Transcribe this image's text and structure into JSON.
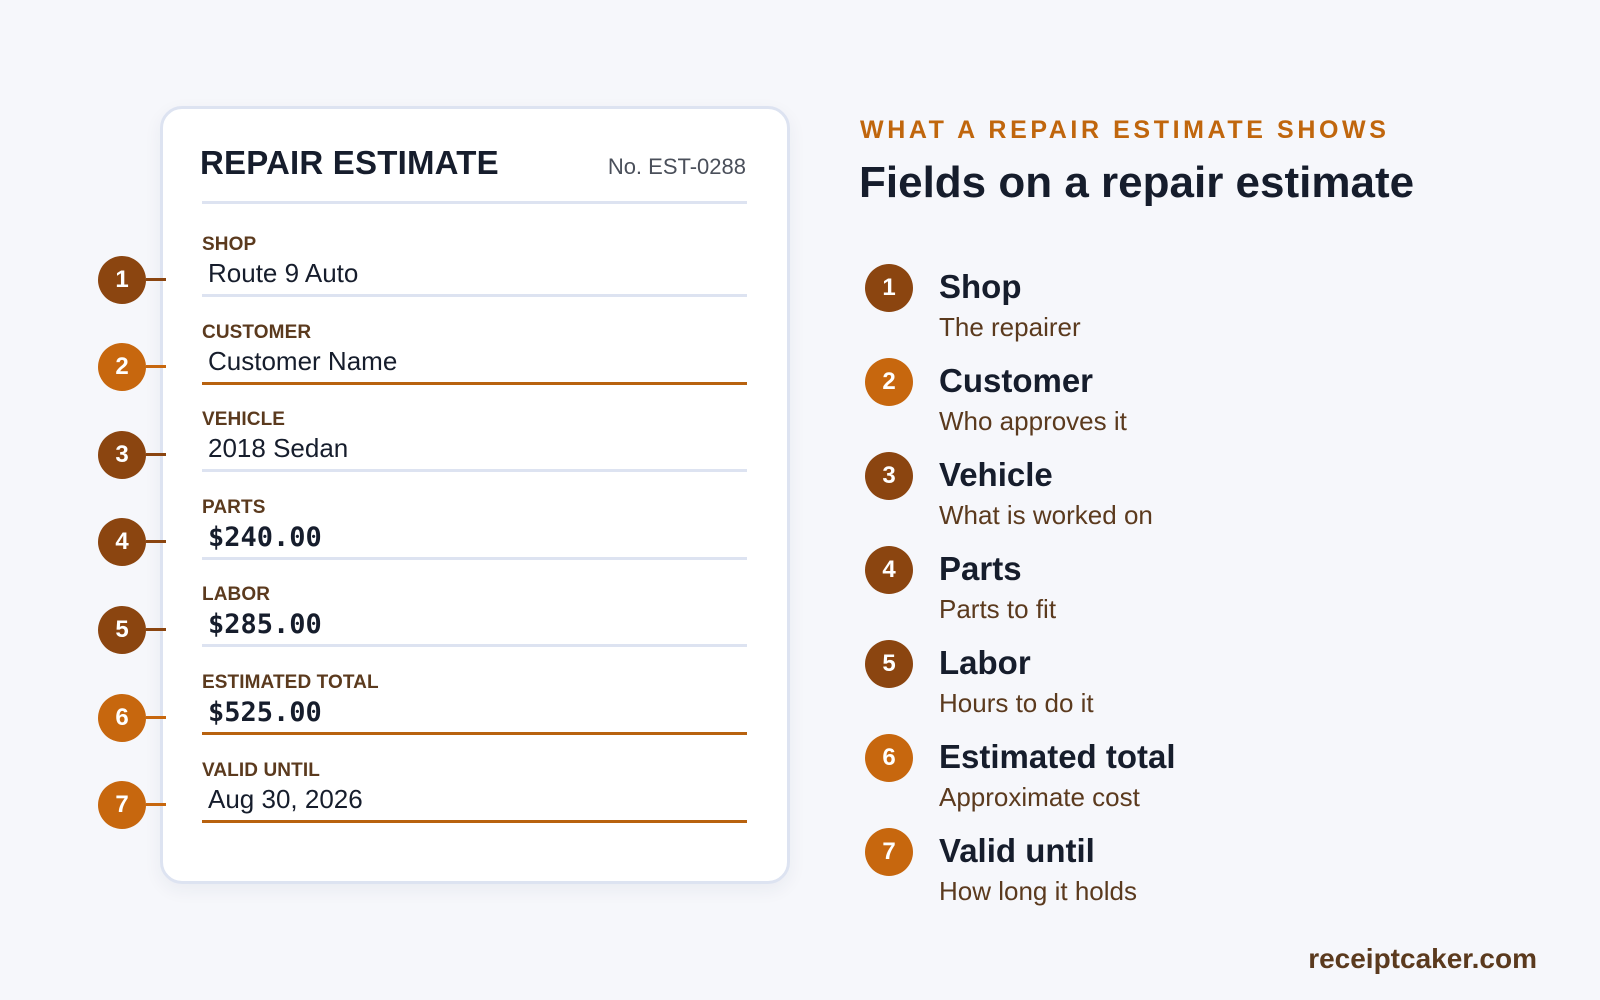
{
  "card": {
    "title": "REPAIR ESTIMATE",
    "number": "No. EST-0288",
    "fields": [
      {
        "marker": "1",
        "label": "SHOP",
        "value": "Route 9 Auto"
      },
      {
        "marker": "2",
        "label": "CUSTOMER",
        "value": "Customer Name"
      },
      {
        "marker": "3",
        "label": "VEHICLE",
        "value": "2018 Sedan"
      },
      {
        "marker": "4",
        "label": "PARTS",
        "value": "$240.00"
      },
      {
        "marker": "5",
        "label": "LABOR",
        "value": "$285.00"
      },
      {
        "marker": "6",
        "label": "ESTIMATED TOTAL",
        "value": "$525.00"
      },
      {
        "marker": "7",
        "label": "VALID UNTIL",
        "value": "Aug 30, 2026"
      }
    ]
  },
  "legend": {
    "eyebrow": "WHAT A REPAIR ESTIMATE SHOWS",
    "heading": "Fields on a repair estimate",
    "items": [
      {
        "number": "1",
        "title": "Shop",
        "description": "The repairer"
      },
      {
        "number": "2",
        "title": "Customer",
        "description": "Who approves it"
      },
      {
        "number": "3",
        "title": "Vehicle",
        "description": "What is worked on"
      },
      {
        "number": "4",
        "title": "Parts",
        "description": "Parts to fit"
      },
      {
        "number": "5",
        "title": "Labor",
        "description": "Hours to do it"
      },
      {
        "number": "6",
        "title": "Estimated total",
        "description": "Approximate cost"
      },
      {
        "number": "7",
        "title": "Valid until",
        "description": "How long it holds"
      }
    ]
  },
  "footer": {
    "brand": "receiptcaker.com"
  },
  "colors": {
    "accent": "#c0660d",
    "marker_dark": "#8b4510",
    "marker_light": "#c7670e",
    "text_dark": "#161d2c",
    "text_brown": "#5b3a1e",
    "divider": "#dde3f1"
  }
}
